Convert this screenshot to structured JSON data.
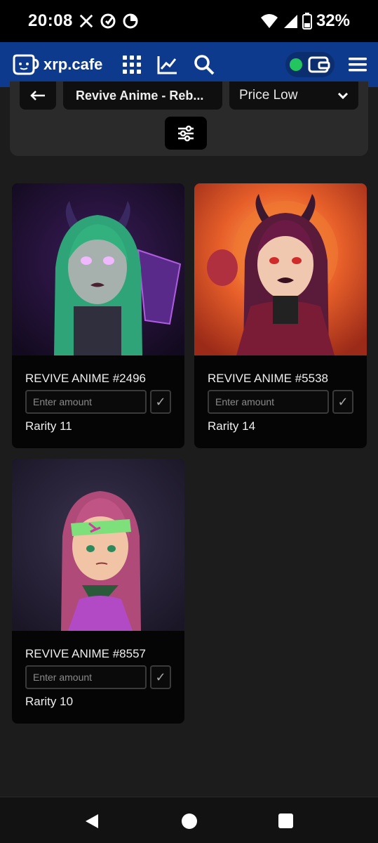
{
  "status_bar": {
    "time": "20:08",
    "battery": "32%"
  },
  "navbar": {
    "logo_text": "xrp.cafe",
    "wallet_status_color": "#22c55e"
  },
  "filters": {
    "collection": "Revive Anime - Reb...",
    "sort": "Price Low"
  },
  "cards": [
    {
      "name": "REVIVE ANIME #2496",
      "placeholder": "Enter amount",
      "rarity": "Rarity 11"
    },
    {
      "name": "REVIVE ANIME #5538",
      "placeholder": "Enter amount",
      "rarity": "Rarity 14"
    },
    {
      "name": "REVIVE ANIME #8557",
      "placeholder": "Enter amount",
      "rarity": "Rarity 10"
    }
  ],
  "colors": {
    "brand": "#0d3a8c",
    "background": "#1c1c1c"
  }
}
